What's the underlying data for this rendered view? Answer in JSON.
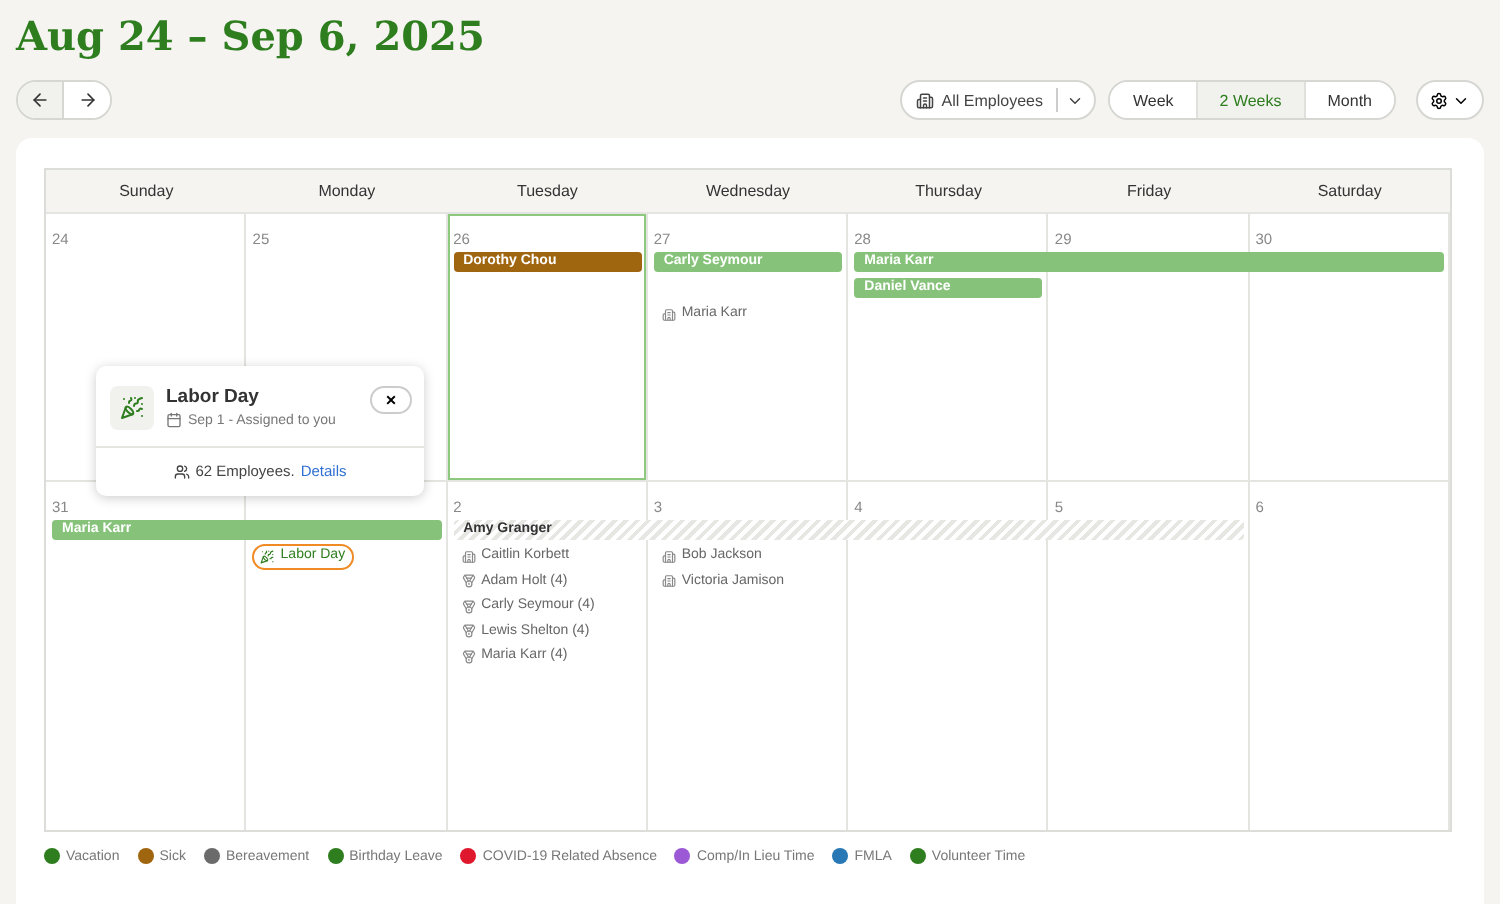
{
  "title": "Aug 24 – Sep 6, 2025",
  "toolbar": {
    "filter": "All Employees",
    "views": [
      {
        "label": "Week",
        "selected": false
      },
      {
        "label": "2 Weeks",
        "selected": true
      },
      {
        "label": "Month",
        "selected": false
      }
    ]
  },
  "weekdays": [
    "Sunday",
    "Monday",
    "Tuesday",
    "Wednesday",
    "Thursday",
    "Friday",
    "Saturday"
  ],
  "weeks": [
    {
      "days": [
        {
          "date": "24",
          "today": false
        },
        {
          "date": "25",
          "today": false
        },
        {
          "date": "26",
          "today": true,
          "events": [
            {
              "name": "Dorothy Chou",
              "kind": "bar",
              "color": "#a0650f"
            }
          ]
        },
        {
          "date": "27",
          "today": false,
          "events": [
            {
              "name": "Carly Seymour",
              "kind": "bar",
              "color": "#86c27a"
            }
          ],
          "items": [
            {
              "kind": "building",
              "label": "Maria Karr",
              "highlighted": false
            }
          ]
        },
        {
          "date": "28",
          "today": false,
          "events": [
            {
              "name": "Maria Karr",
              "kind": "bar",
              "color": "#86c27a"
            },
            {
              "name": "Daniel Vance",
              "kind": "bar",
              "color": "#86c27a"
            }
          ]
        },
        {
          "date": "29",
          "today": false,
          "events": [
            {
              "kind": "continuation"
            }
          ]
        },
        {
          "date": "30",
          "today": false,
          "events": [
            {
              "kind": "continuation"
            }
          ]
        }
      ]
    },
    {
      "days": [
        {
          "date": "31",
          "today": false,
          "events": [
            {
              "name": "Maria Karr",
              "kind": "bar",
              "color": "#86c27a"
            }
          ]
        },
        {
          "today": false,
          "events": [
            {
              "kind": "continuation"
            }
          ],
          "items": [
            {
              "kind": "holiday",
              "label": "Labor Day",
              "highlighted": true
            }
          ]
        },
        {
          "date": "2",
          "today": false,
          "events": [
            {
              "name": "Amy Granger",
              "kind": "hatched",
              "color": "#e6e6e3"
            }
          ],
          "items": [
            {
              "kind": "building",
              "label": "Caitlin Korbett",
              "highlighted": false
            },
            {
              "kind": "medal",
              "label": "Adam Holt (4)",
              "highlighted": false
            },
            {
              "kind": "medal",
              "label": "Carly Seymour (4)",
              "highlighted": false
            },
            {
              "kind": "medal",
              "label": "Lewis Shelton (4)",
              "highlighted": false
            },
            {
              "kind": "medal",
              "label": "Maria Karr (4)",
              "highlighted": false
            }
          ]
        },
        {
          "date": "3",
          "today": false,
          "events": [
            {
              "kind": "continuation"
            }
          ],
          "items": [
            {
              "kind": "building",
              "label": "Bob Jackson",
              "highlighted": false
            },
            {
              "kind": "building",
              "label": "Victoria Jamison",
              "highlighted": false
            }
          ]
        },
        {
          "date": "4",
          "today": false,
          "events": [
            {
              "kind": "continuation"
            }
          ]
        },
        {
          "date": "5",
          "today": false,
          "events": [
            {
              "kind": "continuation"
            }
          ]
        },
        {
          "date": "6",
          "today": false
        }
      ]
    }
  ],
  "popover": {
    "title": "Labor Day",
    "subtitle": "Sep 1 - Assigned to you",
    "close": "×",
    "employees": "62 Employees.",
    "link": "Details"
  },
  "legend": [
    {
      "label": "Vacation",
      "color": "#2e7d1e"
    },
    {
      "label": "Sick",
      "color": "#a0650f"
    },
    {
      "label": "Bereavement",
      "color": "#6b6b6b"
    },
    {
      "label": "Birthday Leave",
      "color": "#2e7d1e"
    },
    {
      "label": "COVID-19 Related Absence",
      "color": "#e0182d"
    },
    {
      "label": "Comp/In Lieu Time",
      "color": "#9b59d6"
    },
    {
      "label": "FMLA",
      "color": "#2878b5"
    },
    {
      "label": "Volunteer Time",
      "color": "#2e7d1e"
    }
  ]
}
